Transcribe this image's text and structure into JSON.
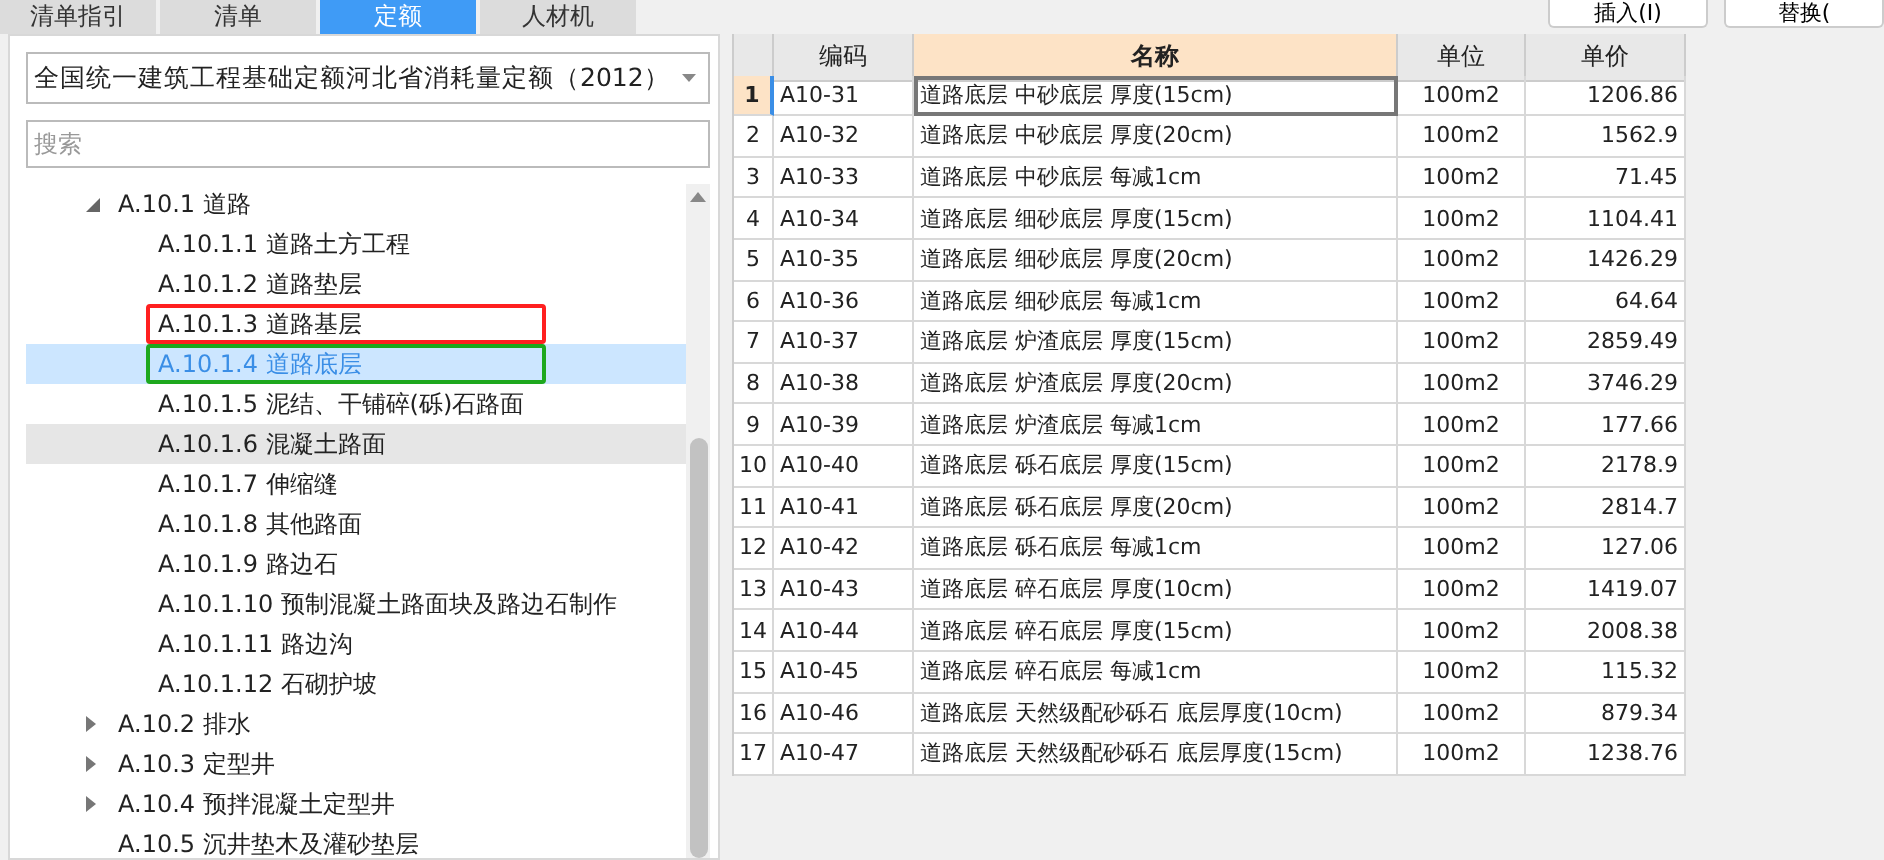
{
  "tabs": [
    {
      "label": "清单指引",
      "selected": false
    },
    {
      "label": "清单",
      "selected": false
    },
    {
      "label": "定额",
      "selected": true
    },
    {
      "label": "人材机",
      "selected": false
    }
  ],
  "toolbar_buttons": [
    "插入(I)",
    "替换("
  ],
  "library_select": {
    "value": "全国统一建筑工程基础定额河北省消耗量定额（2012）"
  },
  "search": {
    "placeholder": "搜索"
  },
  "tree": [
    {
      "label": "A.10.1 道路",
      "expanded": true,
      "selected": false,
      "highlighted": false,
      "children": [
        {
          "label": "A.10.1.1 道路土方工程",
          "selected": false,
          "highlighted": false
        },
        {
          "label": "A.10.1.2 道路垫层",
          "selected": false,
          "highlighted": false
        },
        {
          "label": "A.10.1.3 道路基层",
          "selected": false,
          "highlighted": false,
          "color": "#ff2020"
        },
        {
          "label": "A.10.1.4 道路底层",
          "selected": true,
          "highlighted": false,
          "color": "#1ea81e"
        },
        {
          "label": "A.10.1.5 泥结、干铺碎(砾)石路面",
          "selected": false,
          "highlighted": false
        },
        {
          "label": "A.10.1.6 混凝土路面",
          "selected": false,
          "highlighted": true
        },
        {
          "label": "A.10.1.7 伸缩缝",
          "selected": false,
          "highlighted": false
        },
        {
          "label": "A.10.1.8 其他路面",
          "selected": false,
          "highlighted": false
        },
        {
          "label": "A.10.1.9 路边石",
          "selected": false,
          "highlighted": false
        },
        {
          "label": "A.10.1.10 预制混凝土路面块及路边石制作",
          "selected": false,
          "highlighted": false
        },
        {
          "label": "A.10.1.11 路边沟",
          "selected": false,
          "highlighted": false
        },
        {
          "label": "A.10.1.12 石砌护坡",
          "selected": false,
          "highlighted": false
        }
      ]
    },
    {
      "label": "A.10.2 排水",
      "expanded": false,
      "selected": false,
      "highlighted": false
    },
    {
      "label": "A.10.3 定型井",
      "expanded": false,
      "selected": false,
      "highlighted": false
    },
    {
      "label": "A.10.4 预拌混凝土定型井",
      "expanded": false,
      "selected": false,
      "highlighted": false
    },
    {
      "label": "A.10.5 沉井垫木及灌砂垫层",
      "selected": false,
      "highlighted": false
    }
  ],
  "table": {
    "columns": [
      "编码",
      "名称",
      "单位",
      "单价"
    ],
    "rows": [
      {
        "number": "1",
        "selected": true,
        "cells": [
          "A10-31",
          "道路底层 中砂底层 厚度(15cm)",
          "100m2",
          "1206.86"
        ]
      },
      {
        "number": "2",
        "selected": false,
        "cells": [
          "A10-32",
          "道路底层 中砂底层 厚度(20cm)",
          "100m2",
          "1562.9"
        ]
      },
      {
        "number": "3",
        "selected": false,
        "cells": [
          "A10-33",
          "道路底层 中砂底层 每减1cm",
          "100m2",
          "71.45"
        ]
      },
      {
        "number": "4",
        "selected": false,
        "cells": [
          "A10-34",
          "道路底层 细砂底层 厚度(15cm)",
          "100m2",
          "1104.41"
        ]
      },
      {
        "number": "5",
        "selected": false,
        "cells": [
          "A10-35",
          "道路底层 细砂底层 厚度(20cm)",
          "100m2",
          "1426.29"
        ]
      },
      {
        "number": "6",
        "selected": false,
        "cells": [
          "A10-36",
          "道路底层 细砂底层 每减1cm",
          "100m2",
          "64.64"
        ]
      },
      {
        "number": "7",
        "selected": false,
        "cells": [
          "A10-37",
          "道路底层 炉渣底层 厚度(15cm)",
          "100m2",
          "2859.49"
        ]
      },
      {
        "number": "8",
        "selected": false,
        "cells": [
          "A10-38",
          "道路底层 炉渣底层 厚度(20cm)",
          "100m2",
          "3746.29"
        ]
      },
      {
        "number": "9",
        "selected": false,
        "cells": [
          "A10-39",
          "道路底层 炉渣底层 每减1cm",
          "100m2",
          "177.66"
        ]
      },
      {
        "number": "10",
        "selected": false,
        "cells": [
          "A10-40",
          "道路底层 砾石底层 厚度(15cm)",
          "100m2",
          "2178.9"
        ]
      },
      {
        "number": "11",
        "selected": false,
        "cells": [
          "A10-41",
          "道路底层 砾石底层 厚度(20cm)",
          "100m2",
          "2814.7"
        ]
      },
      {
        "number": "12",
        "selected": false,
        "cells": [
          "A10-42",
          "道路底层 砾石底层 每减1cm",
          "100m2",
          "127.06"
        ]
      },
      {
        "number": "13",
        "selected": false,
        "cells": [
          "A10-43",
          "道路底层 碎石底层 厚度(10cm)",
          "100m2",
          "1419.07"
        ]
      },
      {
        "number": "14",
        "selected": false,
        "cells": [
          "A10-44",
          "道路底层 碎石底层 厚度(15cm)",
          "100m2",
          "2008.38"
        ]
      },
      {
        "number": "15",
        "selected": false,
        "cells": [
          "A10-45",
          "道路底层 碎石底层 每减1cm",
          "100m2",
          "115.32"
        ]
      },
      {
        "number": "16",
        "selected": false,
        "cells": [
          "A10-46",
          "道路底层 天然级配砂砾石 底层厚度(10cm)",
          "100m2",
          "879.34"
        ]
      },
      {
        "number": "17",
        "selected": false,
        "cells": [
          "A10-47",
          "道路底层 天然级配砂砾石 底层厚度(15cm)",
          "100m2",
          "1238.76"
        ]
      }
    ]
  }
}
